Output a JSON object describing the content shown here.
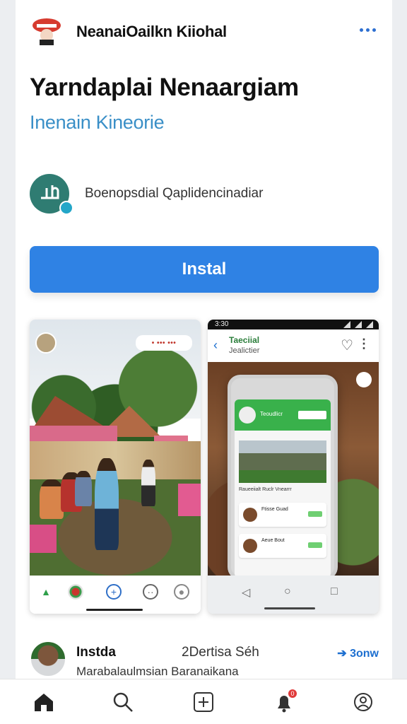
{
  "status_bar": {
    "icons": [
      "signal-icon",
      "cellular-icon",
      "wifi-icon",
      "battery-icon"
    ]
  },
  "app_bar": {
    "app_name": "NeanaiOailkn Kiiohal",
    "logo_icon": "brand-logo-icon",
    "menu_icon": "more-horizontal-icon"
  },
  "app": {
    "title": "Yarndaplai Nenaargiam",
    "subtitle": "Inenain Kineorie",
    "developer": "Boenopsdial Qaplidencinadiar",
    "install_label": "Instal",
    "accent_color": "#2f82e4"
  },
  "screenshots": {
    "first": {
      "overlay_label": "• ••• •••",
      "nav_icons": [
        "app-icon",
        "camera-icon",
        "add-icon",
        "chat-icon",
        "profile-icon"
      ]
    },
    "second": {
      "status_time": "3:30",
      "header_title": "Taeciial",
      "header_subtitle": "Jealictier",
      "phone_title": "Teoudlicr",
      "phone_caption": "Raueeiialt Ruclr Vnearrr",
      "phone_rows": [
        "Ftisse Guad",
        "Aeue Bout"
      ],
      "nav_icons": [
        "back-icon",
        "home-icon",
        "recent-apps-icon"
      ]
    }
  },
  "review": {
    "name": "Instda",
    "meta": "2Dertisa Séh",
    "link": "➔ 3onw",
    "text": "Marabalaulmsian Baranaikana"
  },
  "bottom_nav": {
    "items": [
      "home-icon",
      "search-icon",
      "add-icon",
      "notifications-icon",
      "profile-icon"
    ],
    "notification_count": "0"
  }
}
